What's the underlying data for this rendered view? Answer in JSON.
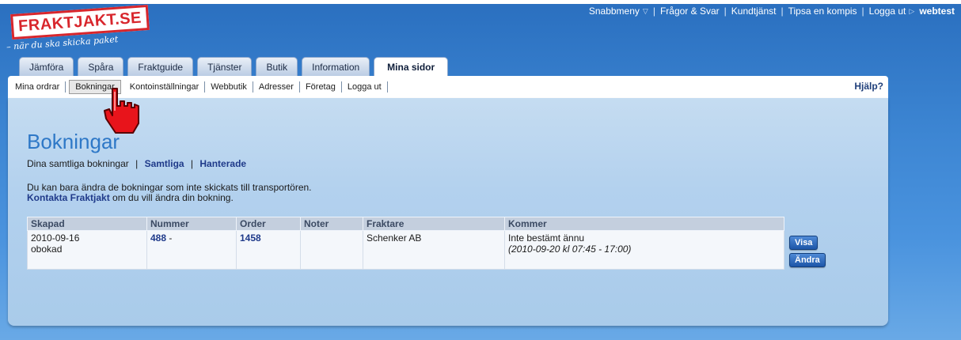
{
  "logo": {
    "name": "FRAKTJAKT.SE",
    "tagline": "– när du ska skicka paket"
  },
  "topnav": {
    "quick_menu": "Snabbmeny",
    "faq": "Frågor & Svar",
    "customer_service": "Kundtjänst",
    "tip_friend": "Tipsa en kompis",
    "logout": "Logga ut",
    "user": "webtest"
  },
  "tabs": [
    "Jämföra",
    "Spåra",
    "Fraktguide",
    "Tjänster",
    "Butik",
    "Information",
    "Mina sidor"
  ],
  "subnav": {
    "items": [
      "Mina ordrar",
      "Bokningar",
      "Kontoinställningar",
      "Webbutik",
      "Adresser",
      "Företag",
      "Logga ut"
    ],
    "help": "Hjälp?"
  },
  "main": {
    "title": "Bokningar",
    "filter_text": "Dina samtliga bokningar",
    "filter_all": "Samtliga",
    "filter_handled": "Hanterade",
    "info_line1": "Du kan bara ändra de bokningar som inte skickats till transportören.",
    "info_link": "Kontakta Fraktjakt",
    "info_line2": " om du vill ändra din bokning."
  },
  "table": {
    "headers": [
      "Skapad",
      "Nummer",
      "Order",
      "Noter",
      "Fraktare",
      "Kommer"
    ],
    "rows": [
      {
        "created": "2010-09-16",
        "status": "obokad",
        "number": "488",
        "number_suffix": " -",
        "order": "1458",
        "notes": "",
        "carrier": "Schenker AB",
        "arrival": "Inte bestämt ännu",
        "arrival_window": "(2010-09-20 kl 07:45 - 17:00)"
      }
    ],
    "btn_show": "Visa",
    "btn_change": "Ändra"
  },
  "colors": {
    "accent": "#2e78c7",
    "logo_red": "#d8262c",
    "link": "#1f3a8a"
  }
}
